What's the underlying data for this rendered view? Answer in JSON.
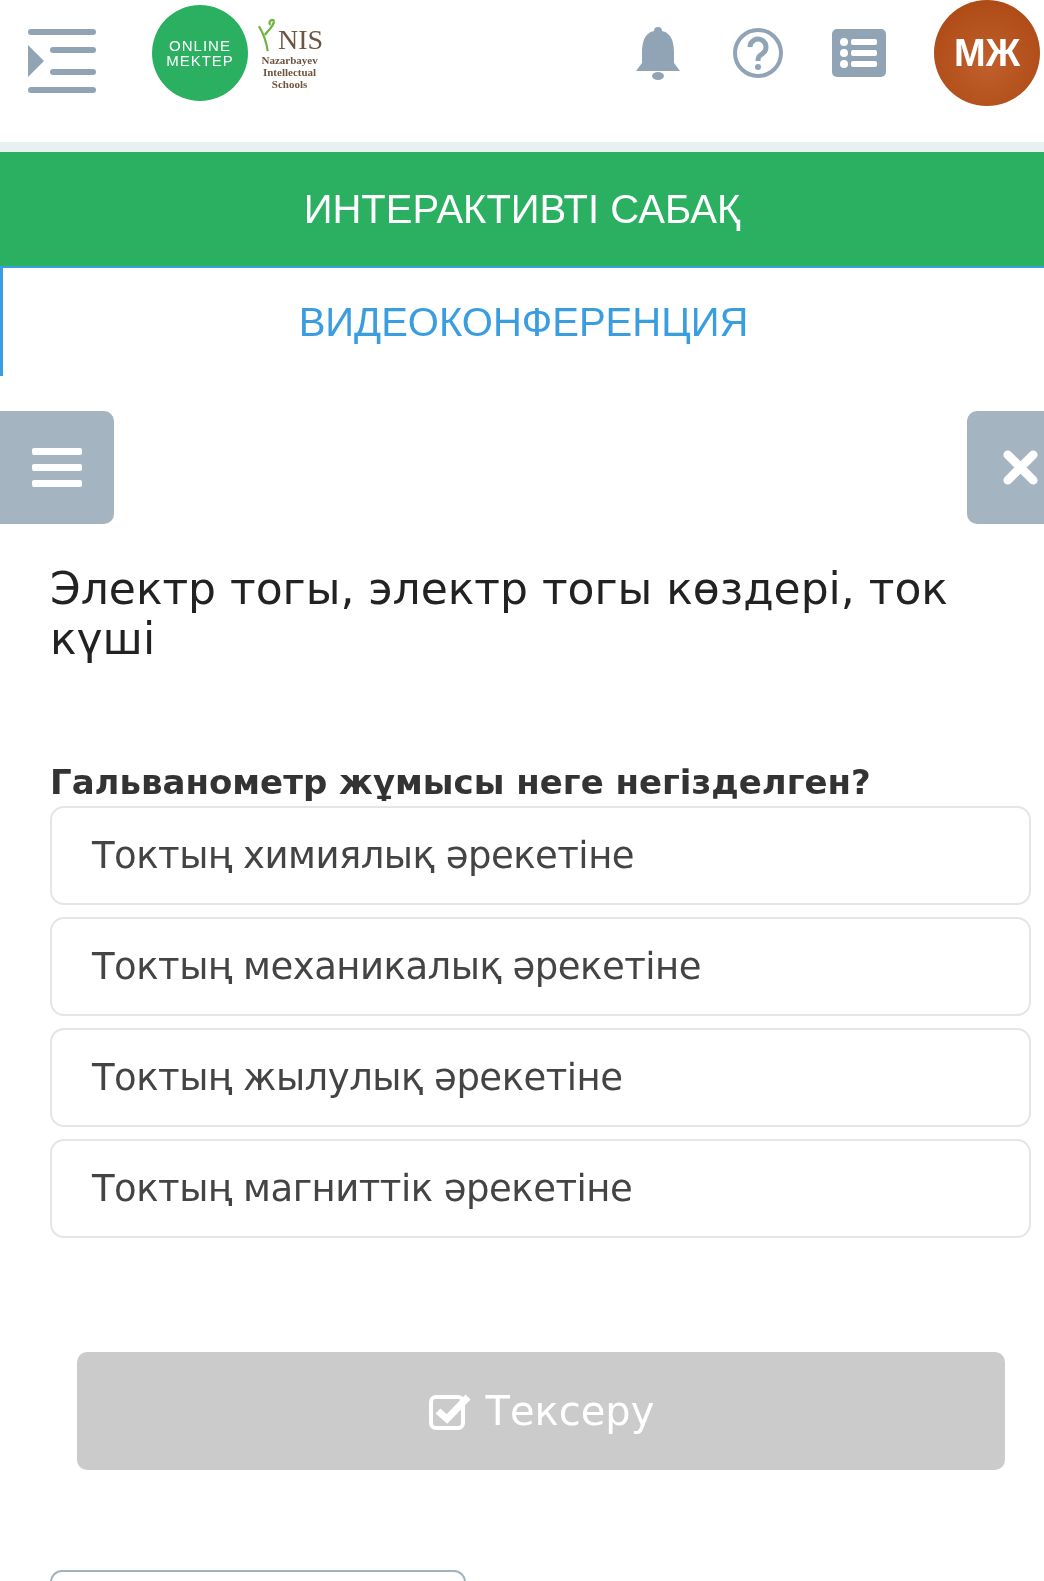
{
  "header": {
    "logo_online": [
      "ONLINE",
      "MEKTEP"
    ],
    "logo_nis": {
      "mark": "NIS",
      "lines": [
        "Nazarbayev",
        "Intellectual",
        "Schools"
      ]
    },
    "avatar": "МЖ"
  },
  "tabs": [
    {
      "label": "ИНТЕРАКТИВТІ САБАҚ",
      "selected": true
    },
    {
      "label": "ВИДЕОКОНФЕРЕНЦИЯ",
      "selected": false
    }
  ],
  "lesson_title": "Электр тогы, электр тогы көздері, ток күші",
  "question": "Гальванометр жұмысы неге негізделген?",
  "options": [
    {
      "label": "Токтың химиялық әрекетіне",
      "selected": false
    },
    {
      "label": "Токтың механикалық әрекетіне",
      "selected": false
    },
    {
      "label": "Токтың жылулық әрекетіне",
      "selected": false
    },
    {
      "label": "Токтың магниттік әрекетіне",
      "selected": false
    }
  ],
  "check_button": {
    "label": "Тексеру",
    "disabled": true
  }
}
